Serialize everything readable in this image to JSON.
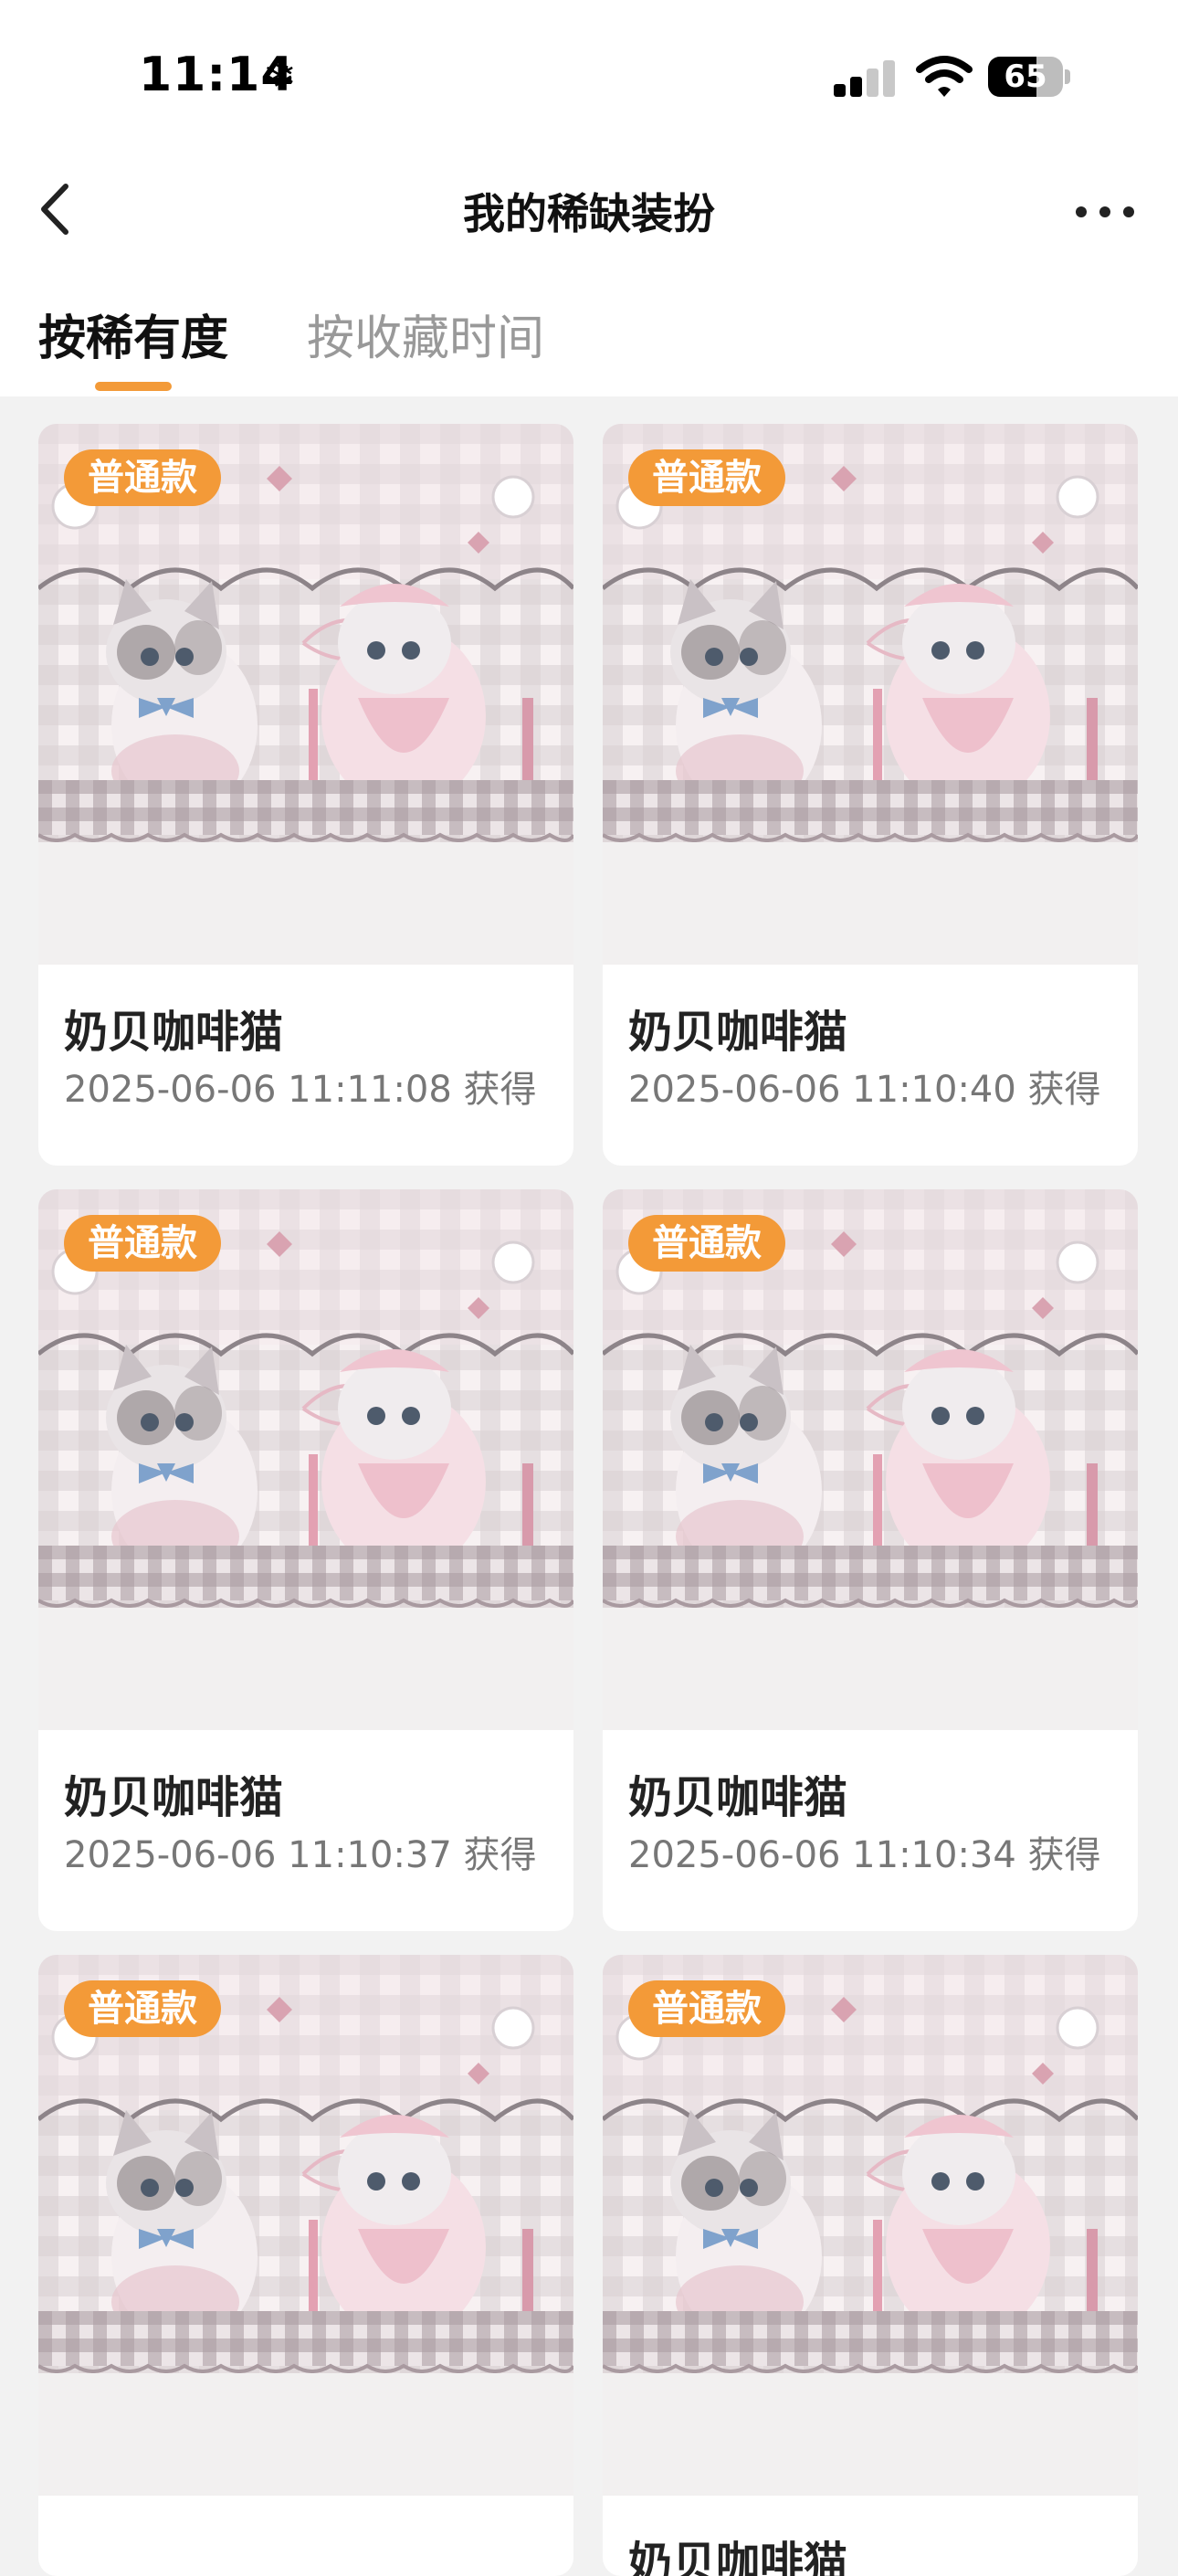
{
  "status_bar": {
    "time": "11:14",
    "snow_symbol": "❄",
    "battery_level": 65,
    "battery_text": "65"
  },
  "nav": {
    "title": "我的稀缺装扮",
    "back_icon": "chevron-left-icon",
    "more_icon": "more-dots-icon"
  },
  "tabs": [
    {
      "label": "按稀有度",
      "active": true
    },
    {
      "label": "按收藏时间",
      "active": false
    }
  ],
  "colors": {
    "accent": "#f39a38",
    "card_bg": "#ffffff",
    "page_bg": "#f2f2f2"
  },
  "cards": [
    {
      "badge": "普通款",
      "name": "奶贝咖啡猫",
      "date": "2025-06-06 11:11:08 获得"
    },
    {
      "badge": "普通款",
      "name": "奶贝咖啡猫",
      "date": "2025-06-06 11:10:40 获得"
    },
    {
      "badge": "普通款",
      "name": "奶贝咖啡猫",
      "date": "2025-06-06 11:10:37 获得"
    },
    {
      "badge": "普通款",
      "name": "奶贝咖啡猫",
      "date": "2025-06-06 11:10:34 获得"
    },
    {
      "badge": "普通款",
      "name": "",
      "date": ""
    },
    {
      "badge": "普通款",
      "name": "奶贝咖啡猫",
      "date": ""
    }
  ]
}
